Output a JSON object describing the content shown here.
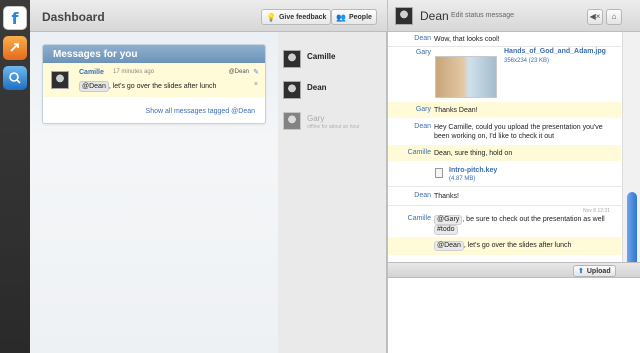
{
  "dock": {
    "apps": [
      "app-logo",
      "share-icon",
      "search-icon"
    ]
  },
  "dashboard": {
    "title": "Dashboard",
    "feedback_label": "Give feedback",
    "people_label": "People"
  },
  "messages_card": {
    "title": "Messages for you",
    "message": {
      "author": "Camille",
      "time": "17 minutes ago",
      "tag": "@Dean",
      "mention": "@Dean",
      "text": ", let's go over the slides after lunch",
      "close": "×"
    },
    "show_all_label": "Show all messages tagged @Dean"
  },
  "people": [
    {
      "name": "Camille",
      "status": ""
    },
    {
      "name": "Dean",
      "status": ""
    },
    {
      "name": "Gary",
      "status": "offline for about an hour"
    }
  ],
  "chat": {
    "name": "Dean",
    "status_prompt": "Edit status message",
    "messages": [
      {
        "who": "Dean",
        "text": "Wow, that looks cool!"
      },
      {
        "who": "Gary",
        "file": "Hands_of_God_and_Adam.jpg",
        "meta": "356x234 (23 KB)"
      },
      {
        "who": "Gary",
        "text": "Thanks Dean!"
      },
      {
        "who": "Dean",
        "text": "Hey Camille, could you upload the presentation you've been working on, I'd like to check it out"
      },
      {
        "who": "Camille",
        "text": "Dean, sure thing, hold on"
      },
      {
        "who": "",
        "file": "Intro-pitch.key",
        "meta": "(4.87 MB)"
      },
      {
        "who": "Dean",
        "text": "Thanks!"
      },
      {
        "who": "Camille",
        "mention": "@Gary",
        "text": ", be sure to check out the presentation as well",
        "tag": "#todo",
        "stamp": "Nov 8 12:31"
      },
      {
        "who": "",
        "mention": "@Dean",
        "text": ", let's go over the slides after lunch"
      }
    ],
    "upload_label": "Upload"
  }
}
